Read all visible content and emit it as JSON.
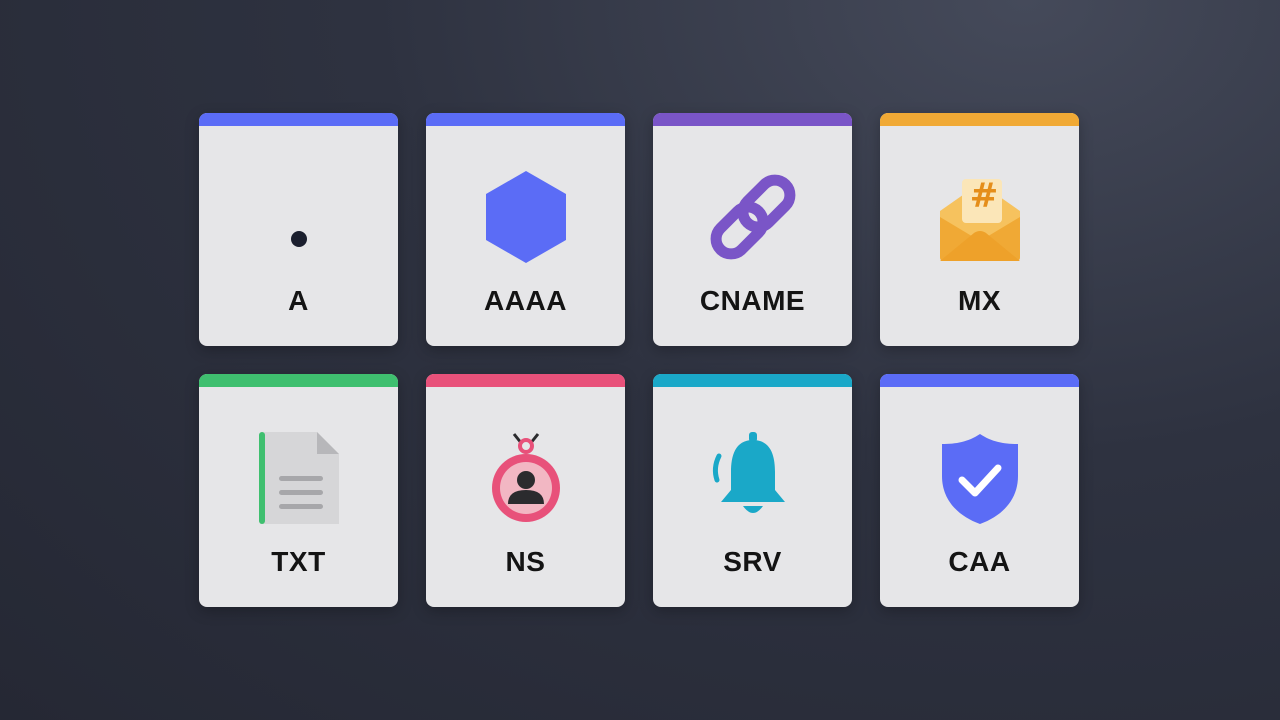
{
  "colors": {
    "indigo": "#5b6cf6",
    "purple": "#7a55c7",
    "amber": "#f0a935",
    "green": "#3fbf6f",
    "pink": "#e8517a",
    "teal": "#1aa8c8"
  },
  "cards": [
    {
      "label": "A",
      "icon": "dot-icon",
      "accent": "#5b6cf6"
    },
    {
      "label": "AAAA",
      "icon": "hexagon-icon",
      "accent": "#5b6cf6"
    },
    {
      "label": "CNAME",
      "icon": "chain-link-icon",
      "accent": "#7a55c7"
    },
    {
      "label": "MX",
      "icon": "envelope-hash-icon",
      "accent": "#f0a935"
    },
    {
      "label": "TXT",
      "icon": "document-icon",
      "accent": "#3fbf6f"
    },
    {
      "label": "NS",
      "icon": "nametag-person-icon",
      "accent": "#e8517a"
    },
    {
      "label": "SRV",
      "icon": "bell-icon",
      "accent": "#1aa8c8"
    },
    {
      "label": "CAA",
      "icon": "shield-check-icon",
      "accent": "#5b6cf6"
    }
  ]
}
